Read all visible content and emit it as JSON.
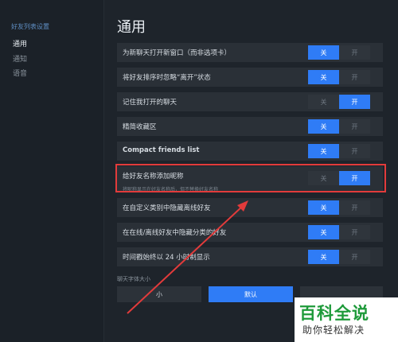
{
  "sidebar": {
    "title": "好友列表设置",
    "items": [
      {
        "label": "通用"
      },
      {
        "label": "通知"
      },
      {
        "label": "语音"
      }
    ]
  },
  "main": {
    "title": "通用",
    "settings": [
      {
        "label": "为新聊天打开新窗口（而非选项卡）",
        "off": "关",
        "on": "开",
        "state": "off"
      },
      {
        "label": "将好友排序时忽略“离开”状态",
        "off": "关",
        "on": "开",
        "state": "off"
      },
      {
        "label": "记住我打开的聊天",
        "off": "关",
        "on": "开",
        "state": "on"
      },
      {
        "label": "精简收藏区",
        "off": "关",
        "on": "开",
        "state": "off"
      },
      {
        "label": "Compact friends list",
        "off": "关",
        "on": "开",
        "state": "off"
      },
      {
        "label": "给好友名称添加昵称",
        "sub": "将昵称显示在好友名称后，但不替换好友名称",
        "off": "关",
        "on": "开",
        "state": "on"
      },
      {
        "label": "在自定义类别中隐藏离线好友",
        "off": "关",
        "on": "开",
        "state": "off"
      },
      {
        "label": "在在线/离线好友中隐藏分类的好友",
        "off": "关",
        "on": "开",
        "state": "off"
      },
      {
        "label": "时间戳始终以 24 小时制显示",
        "off": "关",
        "on": "开",
        "state": "off"
      }
    ],
    "font_size": {
      "label": "聊天字体大小",
      "options": [
        "小",
        "默认"
      ]
    }
  },
  "watermark": {
    "main": "百科全说",
    "sub": "助你轻松解决"
  },
  "colors": {
    "accent": "#2f7cf6",
    "highlight": "#e23b3b",
    "watermark": "#1e9a3a"
  }
}
